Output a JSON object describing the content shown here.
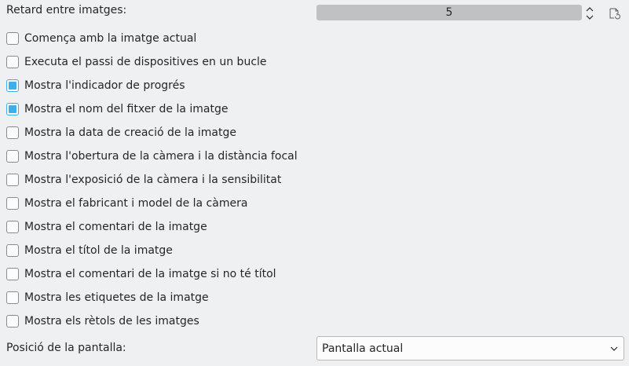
{
  "delay": {
    "label": "Retard entre imatges:",
    "value": "5"
  },
  "options": [
    {
      "label": "Comença amb la imatge actual",
      "checked": false
    },
    {
      "label": "Executa el passi de dispositives en un bucle",
      "checked": false
    },
    {
      "label": "Mostra l'indicador de progrés",
      "checked": true
    },
    {
      "label": "Mostra el nom del fitxer de la imatge",
      "checked": true
    },
    {
      "label": "Mostra la data de creació de la imatge",
      "checked": false
    },
    {
      "label": "Mostra l'obertura de la càmera i la distància focal",
      "checked": false
    },
    {
      "label": "Mostra l'exposició de la càmera i la sensibilitat",
      "checked": false
    },
    {
      "label": "Mostra el fabricant i model de la càmera",
      "checked": false
    },
    {
      "label": "Mostra el comentari de la imatge",
      "checked": false
    },
    {
      "label": "Mostra el títol de la imatge",
      "checked": false
    },
    {
      "label": "Mostra el comentari de la imatge si no té títol",
      "checked": false
    },
    {
      "label": "Mostra les etiquetes de la imatge",
      "checked": false
    },
    {
      "label": "Mostra els rètols de les imatges",
      "checked": false
    }
  ],
  "screen_position": {
    "label": "Posició de la pantalla:",
    "value": "Pantalla actual"
  },
  "colors": {
    "accent": "#3daee9",
    "background": "#eff0f1",
    "spinbox_fill": "#bfc1c3"
  },
  "icons": {
    "spin_arrows": "up-down-chevron-icon",
    "reset": "reset-default-icon",
    "combo_arrow": "chevron-down-icon"
  }
}
